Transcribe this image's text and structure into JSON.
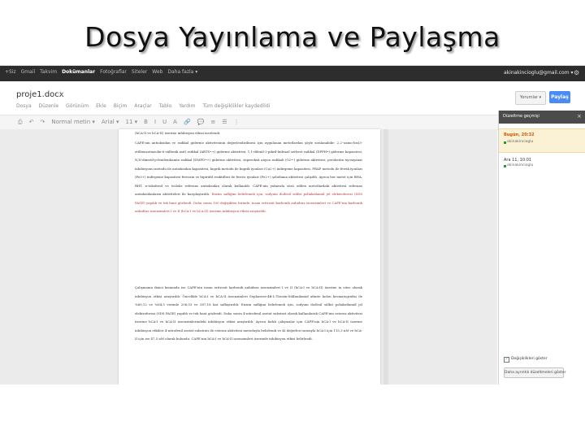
{
  "slide": {
    "title": "Dosya Yayınlama ve Paylaşma"
  },
  "gbar": {
    "links": [
      "+Siz",
      "Gmail",
      "Takvim",
      "Dokümanlar",
      "Fotoğraflar",
      "Siteler",
      "Web",
      "Daha fazla ▾"
    ],
    "active_index": 3,
    "account": "akinakincioglu@gmail.com ▾"
  },
  "doc": {
    "title": "proje1.docx",
    "menu": [
      "Dosya",
      "Düzenle",
      "Görünüm",
      "Ekle",
      "Biçim",
      "Araçlar",
      "Tablo",
      "Yardım",
      "Tüm değişiklikler kaydedildi"
    ],
    "comments_label": "Yorumlar ▾",
    "share_label": "Paylaş",
    "toolbar_icons": [
      "print-icon",
      "undo-icon",
      "redo-icon",
      "font-name",
      "font-size",
      "bold-icon",
      "italic-icon",
      "underline-icon",
      "link-icon",
      "comment-icon",
      "align-icon",
      "list-icon"
    ],
    "toolbar_glyphs": [
      "⎙",
      "↶",
      "↷",
      "Normal metin ▾",
      "Arial ▾",
      "11 ▾",
      "B",
      "I",
      "U",
      "A",
      "🔗",
      "💬",
      "≡",
      "☰",
      "⋮"
    ]
  },
  "body_paragraphs": [
    {
      "text": "(hCA-II ve bCA-II) üzerine inhibisyon etkisi incelendi.",
      "highlight": ""
    },
    {
      "text": "CAPE'nin antioksidan ve radikal giderme aktivitesinin değerlendirilmesi için uygulanan metotlardan şöyle sıralanabilir: 2,2'-azino-bis(3-etilbenzotiazolin-6-sülfonik asit) radikal (ABTS•+) giderme aktivitesi, 1,1-difenil-2-pikril-hidrazil serbest radikal (DPPH•) giderme kapasitesi, N,N-dimetil-p-fenilendiamin radikal (DMPD•+) giderme aktivitesi, süperoksit anyon radikali (O2•-) giderme aktivitesi, peroksitin tiyosiyanat inhibisyonu metodu ile antioksidan kapasitesi, kuprik metodu ile kuprik iyonları (Cu2+) indirgeme kapasitesi, FRAP metodu ile ferrik iyonları (Fe3+) indirgeme kapasitesi ferrozin ve bipiridil reaktifleri ile ferröz iyonları (Fe2+) şelatlama aktivitesi çalışıldı. Ayrıca her metot için BHA, BHT, α-tokoferol ve troloks referans antioksidan olarak kullanıldı. CAPE'nin yukarıda sözü edilen metotlardaki aktivitesi referans antioksidanların aktiviteleri ile karşılaştırıldı.",
      "highlight": "Enzim saflığını belirlemek için, sodyum dodesil sülfat poliakrilamid jel elektroforezi (SDS PAGE) yapıldı ve tek bant gözlendi. Daha sonra 100 değişikten birinde, insan eritrosit karbonik anhidraz izoenzimleri ve CAPE'nin karbonik anhidraz izoenzimleri I ve II (hCA-I ve hCA-II) üzerine inhibisyon etkisi araştırıldı."
    },
    {
      "text": "Çalışmanın ikinci kısmında ise CAPE'nin insan eritrosit karbonik anhidraz izoenzimleri I ve II (hCA-I ve hCA-II) üzerine in vitro olarak inhibisyon etkisi araştırıldı. Öncelikle hCA-I ve hCA-II izoenzimleri Sepharose-4B-L-Tirozin-Sülfanilamid afinite kolon kromatografisi ile %69,12 ve %64,5 verimle 206,53 ve 387,18 kat saflaştırıldı. Enzim saflığını belirlemek için, sodyum dodesil sülfat poliakrilamid jel elektroforezi (SDS PAGE) yapıldı ve tek bant gözlendi. Daha sonra 4-nitrofenil asetat substrat olarak kullanılarak CAPE'nin esteraz aktivitesi üzerine hCA-I ve hCA-II izoenzimlerindeki inhibisyon etkisi araştırıldı. Ayrıca farklı çalışmalar için CAPE'nin hCA-I ve hCA-II üzerine inhibisyon etkileri 4-nitrofenil asetat substratı ile esteraz aktivitesi metoduyla belirlendi ve Ki değerleri sırasıyla hCA-I için 115,3 nM ve hCA-II için ise 47,5 nM olarak bulundu. CAPE'nin hCA-I ve hCA-II izoenzimleri üzerinde inhibisyon etkisi belirlendi.",
      "highlight": ""
    }
  ],
  "revisions": {
    "header": "Düzeltme geçmişi",
    "close_glyph": "×",
    "items": [
      {
        "date": "Bugün, 20:32",
        "user": "akinakincioglu"
      },
      {
        "date": "Ara 11, 10:01",
        "user": "akinakincioglu"
      }
    ],
    "option_label": "Değişiklikleri göster",
    "check_glyph": "✓",
    "restore_label": "Daha ayrıntılı düzeltmeleri göster"
  },
  "colors": {
    "gbar_bg": "#2d2d2d",
    "share_blue": "#4a8bf5",
    "revision_date": "#d35400",
    "highlight_red": "#bb3333"
  }
}
